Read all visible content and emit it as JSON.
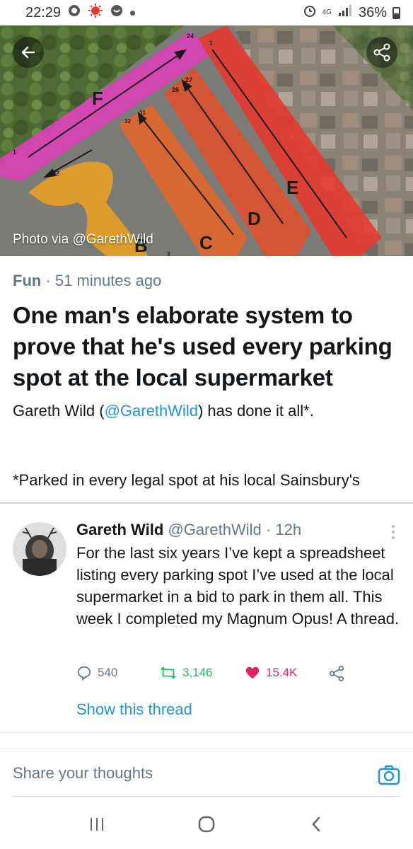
{
  "status_bar": {
    "time": "22:29",
    "network": "4G",
    "battery": "36%"
  },
  "hero": {
    "caption": "Photo via @GarethWild",
    "map_labels": {
      "lanes": [
        "F",
        "E",
        "D",
        "C",
        "B"
      ],
      "numbers": [
        "24",
        "1",
        "27",
        "26",
        "31",
        "32",
        "1",
        "32",
        "3"
      ]
    },
    "icons": [
      "back-arrow-icon",
      "share-icon"
    ]
  },
  "article": {
    "category": "Fun",
    "separator": "·",
    "time": "51 minutes ago",
    "headline": "One man's elaborate system to prove that he's used every parking spot at the local supermarket",
    "desc_prefix": "Gareth Wild (",
    "desc_handle": "@GarethWild",
    "desc_suffix": ") has done it all*.",
    "footnote": "*Parked in every legal spot at his local Sainsbury's"
  },
  "tweet": {
    "name": "Gareth Wild",
    "handle": "@GarethWild",
    "separator": "·",
    "time": "12h",
    "text": "For the last six years I’ve kept a spreadsheet listing every parking spot I’ve used at the local supermarket in a bid to park in them all. This week I completed my Magnum Opus! A thread.",
    "replies": "540",
    "retweets": "3,146",
    "likes": "15.4K",
    "show_thread": "Show this thread"
  },
  "composer": {
    "placeholder": "Share your thoughts"
  },
  "colors": {
    "link": "#1b95e0",
    "retweet": "#17bf63",
    "like": "#e0245e",
    "muted": "#657786"
  }
}
